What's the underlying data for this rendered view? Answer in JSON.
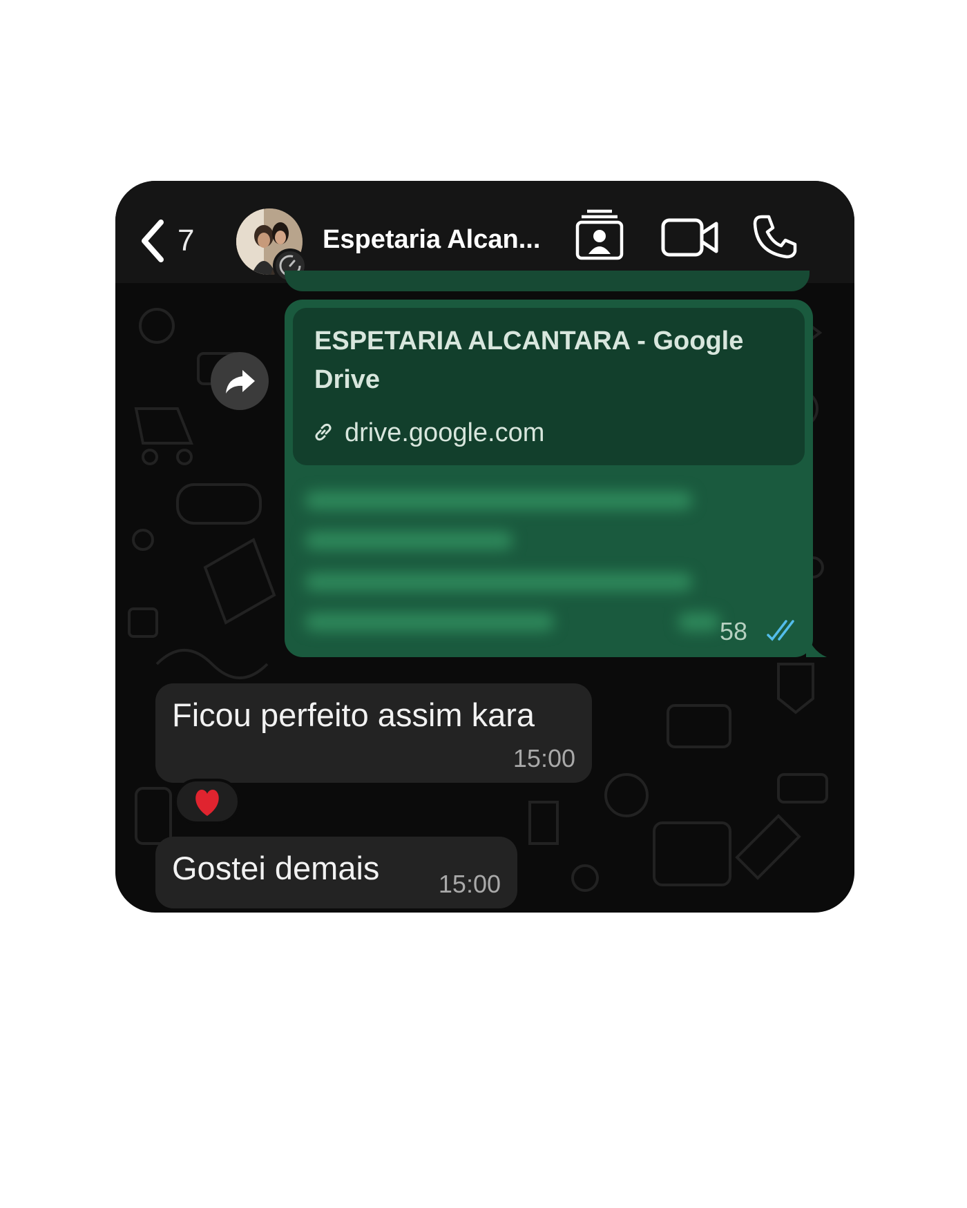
{
  "header": {
    "back_count": "7",
    "contact_name": "Espetaria Alcan...",
    "icons": [
      "back-chevron-icon",
      "contact-card-icon",
      "video-call-icon",
      "phone-icon"
    ]
  },
  "chat": {
    "link_message": {
      "preview_title": "ESPETARIA ALCANTARA - Google Drive",
      "preview_domain": "drive.google.com",
      "time": "58",
      "status": "read"
    },
    "messages": [
      {
        "text": "Ficou perfeito assim kara",
        "time": "15:00",
        "reaction": "❤️"
      },
      {
        "text": "Gostei demais",
        "time": "15:00"
      }
    ]
  },
  "colors": {
    "background": "#0b0b0b",
    "header": "#151515",
    "outgoing_bubble": "#1a5a3e",
    "incoming_bubble": "#232323",
    "read_ticks": "#53bdeb"
  }
}
